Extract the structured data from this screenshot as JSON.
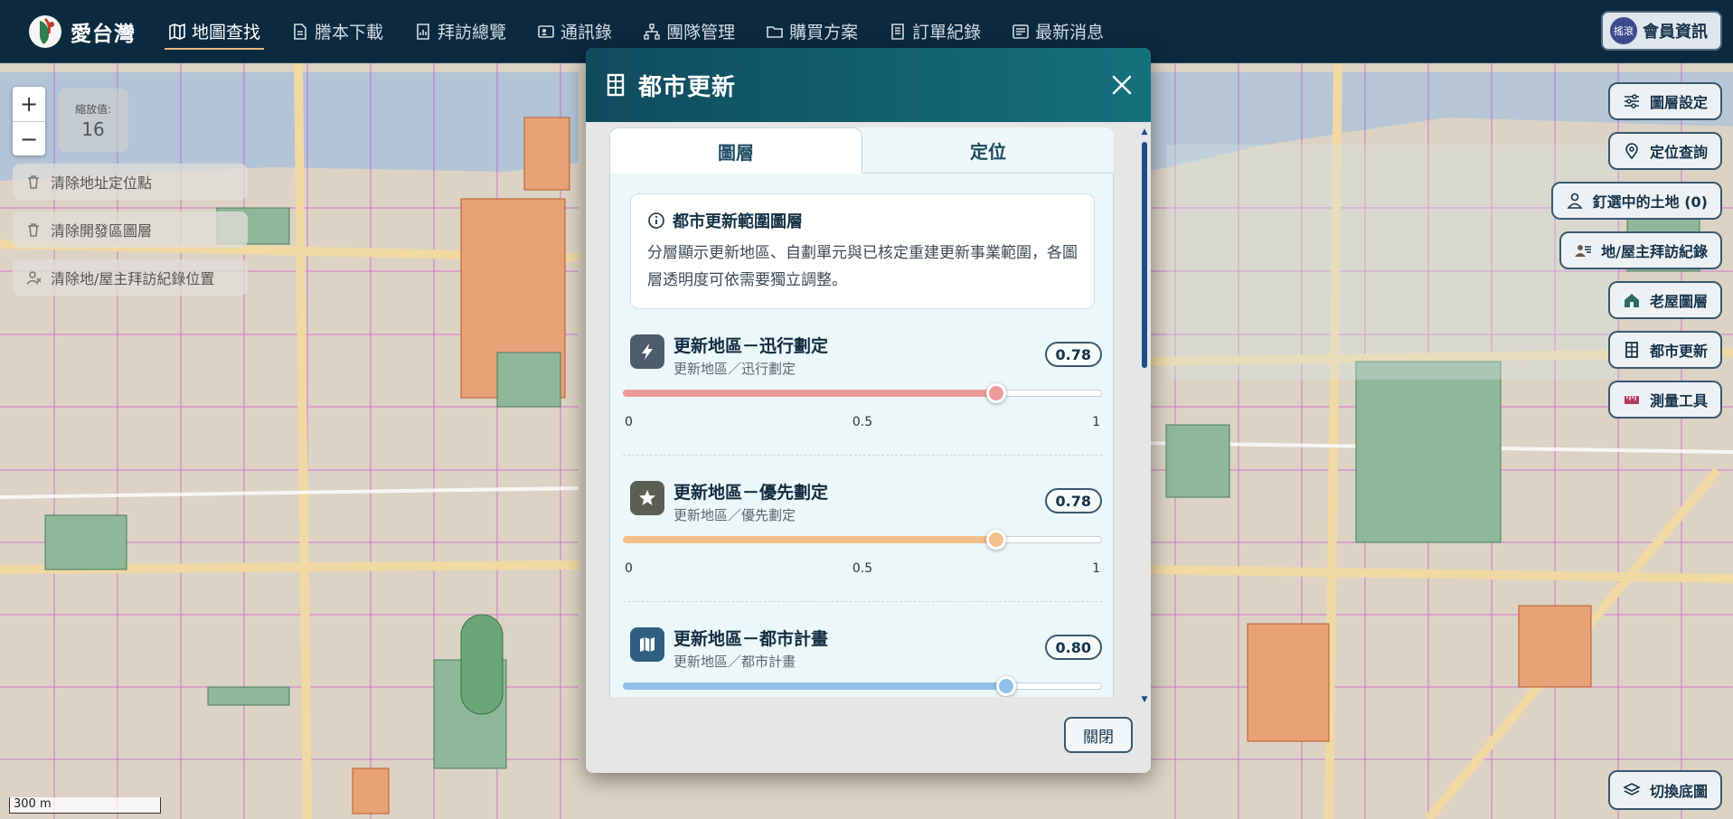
{
  "app": {
    "brand": "愛台灣",
    "logo_icon": "app-logo-icon"
  },
  "nav": {
    "items": [
      {
        "label": "地圖查找",
        "icon": "map-icon",
        "active": true
      },
      {
        "label": "謄本下載",
        "icon": "document-icon"
      },
      {
        "label": "拜訪總覽",
        "icon": "report-icon"
      },
      {
        "label": "通訊錄",
        "icon": "contact-card-icon"
      },
      {
        "label": "團隊管理",
        "icon": "team-icon"
      },
      {
        "label": "購買方案",
        "icon": "folder-icon"
      },
      {
        "label": "訂單紀錄",
        "icon": "receipt-icon"
      },
      {
        "label": "最新消息",
        "icon": "news-icon"
      }
    ],
    "member": {
      "avatar_text": "搖滾",
      "label": "會員資訊"
    }
  },
  "map_controls": {
    "zoom_in": "+",
    "zoom_out": "−",
    "zoom_label": "縮放值:",
    "zoom_value": "16",
    "actions": [
      {
        "label": "清除地址定位點",
        "icon": "trash-icon"
      },
      {
        "label": "清除開發區圖層",
        "icon": "trash-icon"
      },
      {
        "label": "清除地/屋主拜訪紀錄位置",
        "icon": "user-remove-icon"
      }
    ],
    "scale": "300 m"
  },
  "side_buttons": [
    {
      "label": "圖層設定",
      "icon": "sliders-icon"
    },
    {
      "label": "定位查詢",
      "icon": "location-pin-icon"
    },
    {
      "label": "釘選中的土地 (0)",
      "icon": "user-icon"
    },
    {
      "label": "地/屋主拜訪紀錄",
      "icon": "user-group-icon"
    },
    {
      "label": "老屋圖層",
      "icon": "house-icon"
    },
    {
      "label": "都市更新",
      "icon": "building-icon"
    },
    {
      "label": "測量工具",
      "icon": "ruler-icon"
    },
    {
      "label": "切換底圖",
      "icon": "layers-icon"
    }
  ],
  "modal": {
    "title": "都市更新",
    "tabs": [
      {
        "label": "圖層",
        "active": true
      },
      {
        "label": "定位"
      }
    ],
    "info": {
      "title": "都市更新範圍圖層",
      "description": "分層顯示更新地區、自劃單元與已核定重建更新事業範圍，各圖層透明度可依需要獨立調整。"
    },
    "layers": [
      {
        "name": "更新地區－迅行劃定",
        "sub": "更新地區／迅行劃定",
        "opacity": 0.78,
        "opacity_label": "0.78",
        "color": "#ef9a9a",
        "icon": "lightning-icon",
        "icon_bg": "#4f5b6a"
      },
      {
        "name": "更新地區－優先劃定",
        "sub": "更新地區／優先劃定",
        "opacity": 0.78,
        "opacity_label": "0.78",
        "color": "#f3bf8a",
        "icon": "star-icon",
        "icon_bg": "#5a5f52"
      },
      {
        "name": "更新地區－都市計畫",
        "sub": "更新地區／都市計畫",
        "opacity": 0.8,
        "opacity_label": "0.80",
        "color": "#8fc1ea",
        "icon": "map-icon",
        "icon_bg": "#2f5f80"
      }
    ],
    "ticks": {
      "min": "0",
      "mid": "0.5",
      "max": "1"
    },
    "close_button": "關閉"
  }
}
